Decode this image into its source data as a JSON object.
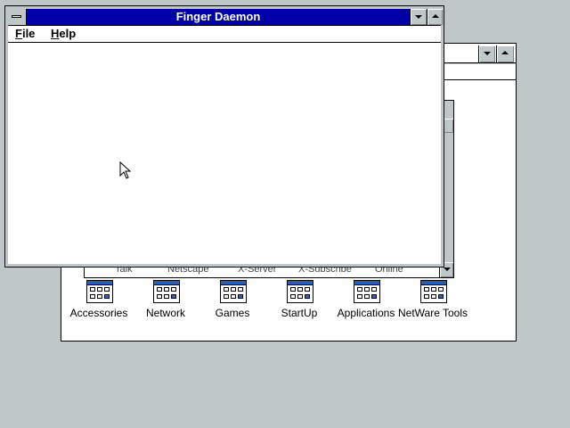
{
  "desktop": {
    "background": "#c0c7c8"
  },
  "finger_window": {
    "title": "Finger Daemon",
    "title_color": "#0000a8",
    "menu": [
      "File",
      "Help"
    ]
  },
  "group_window": {
    "hidden_row_labels": [
      "Talk",
      "Netscape",
      "X-Server",
      "X-Subscribe",
      "Online"
    ],
    "groups": [
      {
        "label": "Accessories",
        "icon": "program-group-icon"
      },
      {
        "label": "Network",
        "icon": "program-group-icon"
      },
      {
        "label": "Games",
        "icon": "program-group-icon"
      },
      {
        "label": "StartUp",
        "icon": "program-group-icon"
      },
      {
        "label": "Applications",
        "icon": "program-group-icon"
      },
      {
        "label": "NetWare Tools",
        "icon": "program-group-icon"
      }
    ]
  }
}
